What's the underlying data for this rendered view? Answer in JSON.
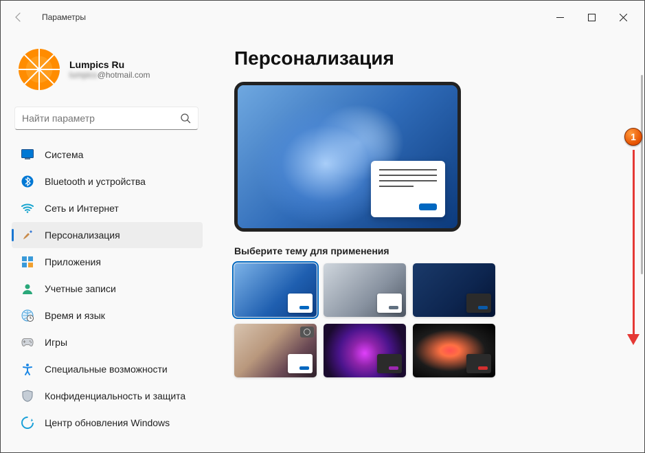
{
  "window": {
    "title": "Параметры"
  },
  "profile": {
    "name": "Lumpics Ru",
    "email_hidden": "lumpics",
    "email_suffix": "@hotmail.com"
  },
  "search": {
    "placeholder": "Найти параметр"
  },
  "nav": [
    {
      "id": "system",
      "label": "Система",
      "icon": "system-icon"
    },
    {
      "id": "bluetooth",
      "label": "Bluetooth и устройства",
      "icon": "bluetooth-icon"
    },
    {
      "id": "network",
      "label": "Сеть и Интернет",
      "icon": "wifi-icon"
    },
    {
      "id": "personalization",
      "label": "Персонализация",
      "icon": "brush-icon",
      "active": true
    },
    {
      "id": "apps",
      "label": "Приложения",
      "icon": "apps-icon"
    },
    {
      "id": "accounts",
      "label": "Учетные записи",
      "icon": "person-icon"
    },
    {
      "id": "time",
      "label": "Время и язык",
      "icon": "clock-globe-icon"
    },
    {
      "id": "gaming",
      "label": "Игры",
      "icon": "gamepad-icon"
    },
    {
      "id": "accessibility",
      "label": "Специальные возможности",
      "icon": "accessibility-icon"
    },
    {
      "id": "privacy",
      "label": "Конфиденциальность и защита",
      "icon": "shield-icon"
    },
    {
      "id": "update",
      "label": "Центр обновления Windows",
      "icon": "update-icon"
    }
  ],
  "page": {
    "title": "Персонализация",
    "theme_section_label": "Выберите тему для применения"
  },
  "themes": [
    {
      "id": "light-blue",
      "selected": true,
      "card": "light",
      "accent": "blue"
    },
    {
      "id": "gray",
      "selected": false,
      "card": "light",
      "accent": "gray"
    },
    {
      "id": "dark-blue",
      "selected": false,
      "card": "dark",
      "accent": "dblue"
    },
    {
      "id": "spotlight",
      "selected": false,
      "card": "light",
      "accent": "blue",
      "camera": true
    },
    {
      "id": "purple-glow",
      "selected": false,
      "card": "dark",
      "accent": "purple"
    },
    {
      "id": "red-flow",
      "selected": false,
      "card": "dark",
      "accent": "red"
    }
  ],
  "annotation": {
    "step": "1"
  }
}
